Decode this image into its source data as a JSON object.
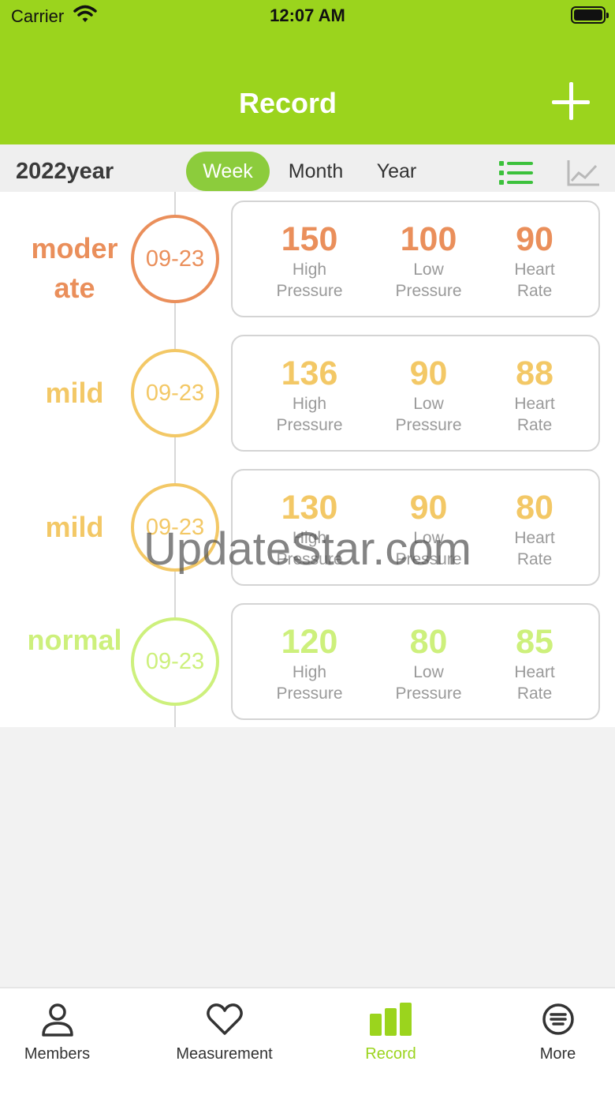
{
  "status_bar": {
    "carrier": "Carrier",
    "time": "12:07 AM"
  },
  "header": {
    "title": "Record"
  },
  "filter": {
    "year": "2022year",
    "tabs": [
      "Week",
      "Month",
      "Year"
    ],
    "selected_tab": "Week"
  },
  "labels": {
    "high": "High\nPressure",
    "low": "Low\nPressure",
    "hr": "Heart\nRate"
  },
  "records": [
    {
      "level": "moderate",
      "date": "09-23",
      "high": "150",
      "low": "100",
      "heart_rate": "90",
      "color": "#ea8f5b"
    },
    {
      "level": "mild",
      "date": "09-23",
      "high": "136",
      "low": "90",
      "heart_rate": "88",
      "color": "#f3c866"
    },
    {
      "level": "mild",
      "date": "09-23",
      "high": "130",
      "low": "90",
      "heart_rate": "80",
      "color": "#f3c866"
    },
    {
      "level": "normal",
      "date": "09-23",
      "high": "120",
      "low": "80",
      "heart_rate": "85",
      "color": "#cdf07c"
    }
  ],
  "watermark": "UpdateStar.com",
  "tabbar": {
    "items": [
      "Members",
      "Measurement",
      "Record",
      "More"
    ],
    "active": "Record",
    "active_color": "#9bd41d"
  }
}
